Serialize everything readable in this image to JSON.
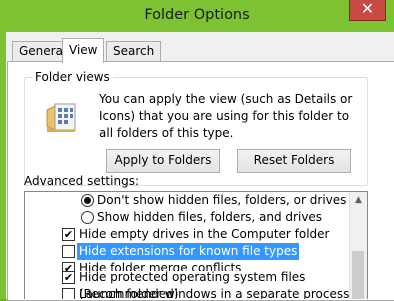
{
  "window": {
    "title": "Folder Options",
    "close_glyph": "✕"
  },
  "tabs": [
    {
      "label": "General"
    },
    {
      "label": "View"
    },
    {
      "label": "Search"
    }
  ],
  "folder_views": {
    "group_label": "Folder views",
    "description": "You can apply the view (such as Details or Icons) that you are using for this folder to all folders of this type.",
    "apply_button": "Apply to Folders",
    "reset_button": "Reset Folders",
    "icon": "folder-view-icon"
  },
  "advanced": {
    "label": "Advanced settings:",
    "items": [
      {
        "type": "radio",
        "checked": true,
        "label": "Don't show hidden files, folders, or drives"
      },
      {
        "type": "radio",
        "checked": false,
        "label": "Show hidden files, folders, and drives"
      },
      {
        "type": "checkbox",
        "checked": true,
        "label": "Hide empty drives in the Computer folder"
      },
      {
        "type": "checkbox",
        "checked": false,
        "selected": true,
        "label": "Hide extensions for known file types"
      },
      {
        "type": "checkbox",
        "checked": true,
        "label": "Hide folder merge conflicts"
      },
      {
        "type": "checkbox",
        "checked": true,
        "label": "Hide protected operating system files (Recommended)"
      },
      {
        "type": "checkbox",
        "checked": false,
        "label": "Launch folder windows in a separate process"
      }
    ],
    "scroll_up_glyph": "▲",
    "check_glyph": "✔"
  }
}
